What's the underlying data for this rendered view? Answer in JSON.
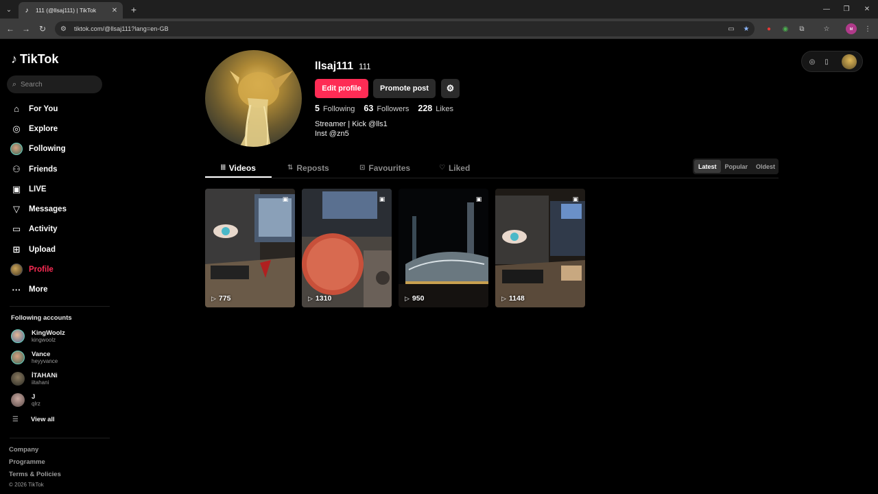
{
  "browser": {
    "tab_title": "111 (@llsaj111) | TikTok",
    "url": "tiktok.com/@llsaj111?lang=en-GB"
  },
  "sidebar": {
    "logo": "TikTok",
    "search_placeholder": "Search",
    "nav": [
      {
        "label": "For You",
        "icon": "home-icon"
      },
      {
        "label": "Explore",
        "icon": "compass-icon"
      },
      {
        "label": "Following",
        "icon": "following-avatar"
      },
      {
        "label": "Friends",
        "icon": "friends-icon"
      },
      {
        "label": "LIVE",
        "icon": "live-icon"
      },
      {
        "label": "Messages",
        "icon": "send-icon"
      },
      {
        "label": "Activity",
        "icon": "activity-icon"
      },
      {
        "label": "Upload",
        "icon": "upload-icon"
      },
      {
        "label": "Profile",
        "icon": "profile-avatar"
      },
      {
        "label": "More",
        "icon": "more-icon"
      }
    ],
    "following_title": "Following accounts",
    "accounts": [
      {
        "name": "KingWoolz",
        "handle": "kingwoolz"
      },
      {
        "name": "Vance",
        "handle": "heyyvance"
      },
      {
        "name": "İTAHANi",
        "handle": "iitahani"
      },
      {
        "name": "J",
        "handle": "qlrz"
      }
    ],
    "view_all": "View all",
    "footer": {
      "company": "Company",
      "programme": "Programme",
      "terms": "Terms & Policies",
      "copyright": "© 2026 TikTok"
    }
  },
  "profile": {
    "username": "llsaj111",
    "nickname": "111",
    "edit_label": "Edit profile",
    "promote_label": "Promote post",
    "stats": {
      "following": "5",
      "following_label": "Following",
      "followers": "63",
      "followers_label": "Followers",
      "likes": "228",
      "likes_label": "Likes"
    },
    "bio_line1": "Streamer | Kick @lls1",
    "bio_line2": "Inst @zn5"
  },
  "tabs": {
    "videos": "Videos",
    "reposts": "Reposts",
    "favourites": "Favourites",
    "liked": "Liked"
  },
  "sort": {
    "latest": "Latest",
    "popular": "Popular",
    "oldest": "Oldest"
  },
  "videos": [
    {
      "views": "775"
    },
    {
      "views": "1310"
    },
    {
      "views": "950"
    },
    {
      "views": "1148"
    }
  ],
  "colors": {
    "accent": "#fe2c55",
    "background": "#000000"
  }
}
